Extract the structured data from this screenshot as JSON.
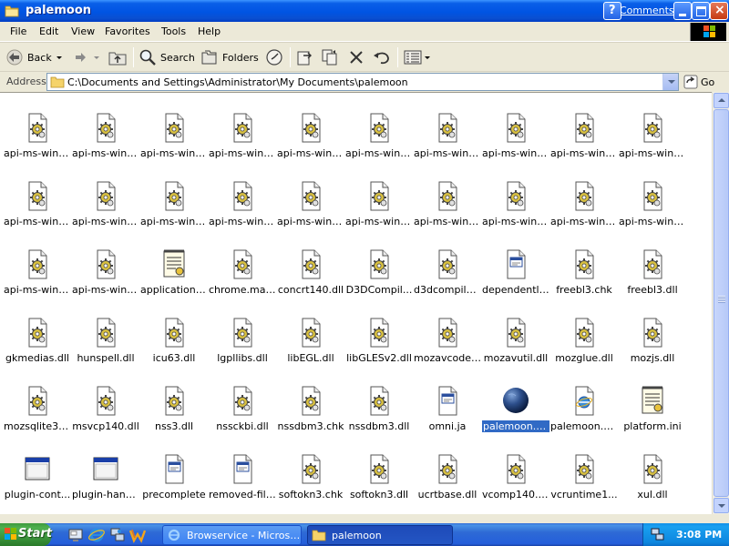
{
  "window": {
    "title": "palemoon",
    "comments_link": "Comments?",
    "help_glyph": "?",
    "close_glyph": "×"
  },
  "menu": [
    "File",
    "Edit",
    "View",
    "Favorites",
    "Tools",
    "Help"
  ],
  "toolbar": {
    "back_label": "Back",
    "search_label": "Search",
    "folders_label": "Folders"
  },
  "address": {
    "label": "Address",
    "path": "C:\\Documents and Settings\\Administrator\\My Documents\\palemoon",
    "go_label": "Go"
  },
  "files": [
    {
      "label": "api-ms-win-...",
      "icon": "dll-gear"
    },
    {
      "label": "api-ms-win-...",
      "icon": "dll-gear"
    },
    {
      "label": "api-ms-win-...",
      "icon": "dll-gear"
    },
    {
      "label": "api-ms-win-...",
      "icon": "dll-gear"
    },
    {
      "label": "api-ms-win-...",
      "icon": "dll-gear"
    },
    {
      "label": "api-ms-win-...",
      "icon": "dll-gear"
    },
    {
      "label": "api-ms-win-...",
      "icon": "dll-gear"
    },
    {
      "label": "api-ms-win-...",
      "icon": "dll-gear"
    },
    {
      "label": "api-ms-win-...",
      "icon": "dll-gear"
    },
    {
      "label": "api-ms-win-...",
      "icon": "dll-gear"
    },
    {
      "label": "api-ms-win-...",
      "icon": "dll-gear"
    },
    {
      "label": "api-ms-win-...",
      "icon": "dll-gear"
    },
    {
      "label": "api-ms-win-...",
      "icon": "dll-gear"
    },
    {
      "label": "api-ms-win-...",
      "icon": "dll-gear"
    },
    {
      "label": "api-ms-win-...",
      "icon": "dll-gear"
    },
    {
      "label": "api-ms-win-...",
      "icon": "dll-gear"
    },
    {
      "label": "api-ms-win-...",
      "icon": "dll-gear"
    },
    {
      "label": "api-ms-win-...",
      "icon": "dll-gear"
    },
    {
      "label": "api-ms-win-...",
      "icon": "dll-gear"
    },
    {
      "label": "api-ms-win-...",
      "icon": "dll-gear"
    },
    {
      "label": "api-ms-win-...",
      "icon": "dll-gear"
    },
    {
      "label": "api-ms-win-...",
      "icon": "dll-gear"
    },
    {
      "label": "application.ini",
      "icon": "ini-settings"
    },
    {
      "label": "chrome.man...",
      "icon": "dll-gear"
    },
    {
      "label": "concrt140.dll",
      "icon": "dll-gear"
    },
    {
      "label": "D3DCompil...",
      "icon": "dll-gear"
    },
    {
      "label": "d3dcompiler...",
      "icon": "dll-gear"
    },
    {
      "label": "dependentli...",
      "icon": "app-window-doc"
    },
    {
      "label": "freebl3.chk",
      "icon": "dll-gear"
    },
    {
      "label": "freebl3.dll",
      "icon": "dll-gear"
    },
    {
      "label": "gkmedias.dll",
      "icon": "dll-gear"
    },
    {
      "label": "hunspell.dll",
      "icon": "dll-gear"
    },
    {
      "label": "icu63.dll",
      "icon": "dll-gear"
    },
    {
      "label": "lgpllibs.dll",
      "icon": "dll-gear"
    },
    {
      "label": "libEGL.dll",
      "icon": "dll-gear"
    },
    {
      "label": "libGLESv2.dll",
      "icon": "dll-gear"
    },
    {
      "label": "mozavcodec...",
      "icon": "dll-gear"
    },
    {
      "label": "mozavutil.dll",
      "icon": "dll-gear"
    },
    {
      "label": "mozglue.dll",
      "icon": "dll-gear"
    },
    {
      "label": "mozjs.dll",
      "icon": "dll-gear"
    },
    {
      "label": "mozsqlite3.dll",
      "icon": "dll-gear"
    },
    {
      "label": "msvcp140.dll",
      "icon": "dll-gear"
    },
    {
      "label": "nss3.dll",
      "icon": "dll-gear"
    },
    {
      "label": "nssckbi.dll",
      "icon": "dll-gear"
    },
    {
      "label": "nssdbm3.chk",
      "icon": "dll-gear"
    },
    {
      "label": "nssdbm3.dll",
      "icon": "dll-gear"
    },
    {
      "label": "omni.ja",
      "icon": "app-window-doc"
    },
    {
      "label": "palemoon.exe",
      "icon": "palemoon-globe",
      "selected": true
    },
    {
      "label": "palemoon.Vi...",
      "icon": "ie-doc"
    },
    {
      "label": "platform.ini",
      "icon": "ini-settings"
    },
    {
      "label": "plugin-cont...",
      "icon": "exe-window"
    },
    {
      "label": "plugin-hang...",
      "icon": "exe-window"
    },
    {
      "label": "precomplete",
      "icon": "app-window-doc"
    },
    {
      "label": "removed-files",
      "icon": "app-window-doc"
    },
    {
      "label": "softokn3.chk",
      "icon": "dll-gear"
    },
    {
      "label": "softokn3.dll",
      "icon": "dll-gear"
    },
    {
      "label": "ucrtbase.dll",
      "icon": "dll-gear"
    },
    {
      "label": "vcomp140.dll",
      "icon": "dll-gear"
    },
    {
      "label": "vcruntime1...",
      "icon": "dll-gear"
    },
    {
      "label": "xul.dll",
      "icon": "dll-gear"
    }
  ],
  "taskbar": {
    "start_label": "Start",
    "quicklaunch": [
      "show-desktop-icon",
      "ie-icon",
      "network-icon",
      "winamp-icon"
    ],
    "tasks": [
      {
        "label": "Browservice - Microsoft ...",
        "active": false
      },
      {
        "label": "palemoon",
        "active": true
      }
    ],
    "clock": "3:08 PM"
  },
  "colors": {
    "title_bar": "#0054E3",
    "selection": "#316AC5",
    "taskbar": "#245EDB",
    "start_green": "#3C9A3C"
  }
}
